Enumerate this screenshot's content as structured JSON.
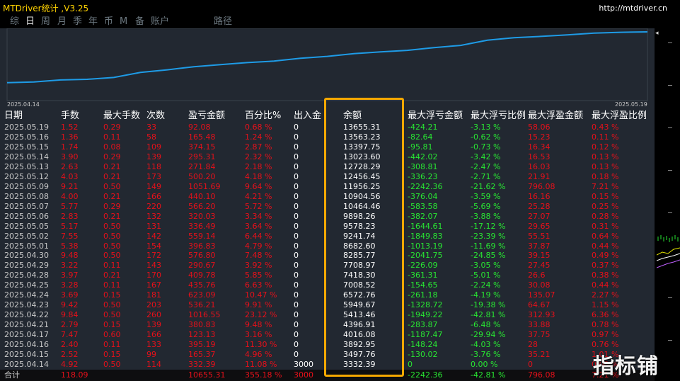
{
  "app": {
    "title": "MTDriver统计 ,V3.25",
    "url": "http://mtdriver.cn"
  },
  "tabs": [
    "综",
    "日",
    "周",
    "月",
    "季",
    "年",
    "币",
    "M",
    "备",
    "账户",
    "路径"
  ],
  "active_tab": 1,
  "chart": {
    "start_label": "2025.04.14",
    "end_label": "2025.05.19",
    "line_color": "#1e9be6"
  },
  "columns": [
    "日期",
    "手数",
    "最大手数",
    "次数",
    "盈亏金额",
    "百分比%",
    "出入金",
    "余额",
    "最大浮亏金额",
    "最大浮亏比例",
    "最大浮盈金额",
    "最大浮盈比例"
  ],
  "rows": [
    [
      "2025.05.19",
      "1.52",
      "0.29",
      "33",
      "92.08",
      "0.68 %",
      "0",
      "13655.31",
      "-424.21",
      "-3.13 %",
      "58.06",
      "0.43 %"
    ],
    [
      "2025.05.16",
      "1.36",
      "0.11",
      "58",
      "165.48",
      "1.24 %",
      "0",
      "13563.23",
      "-82.64",
      "-0.62 %",
      "15.23",
      "0.11 %"
    ],
    [
      "2025.05.15",
      "1.74",
      "0.08",
      "109",
      "374.15",
      "2.87 %",
      "0",
      "13397.75",
      "-95.81",
      "-0.73 %",
      "16.34",
      "0.12 %"
    ],
    [
      "2025.05.14",
      "3.90",
      "0.29",
      "139",
      "295.31",
      "2.32 %",
      "0",
      "13023.60",
      "-442.02",
      "-3.42 %",
      "16.53",
      "0.13 %"
    ],
    [
      "2025.05.13",
      "2.63",
      "0.21",
      "118",
      "271.84",
      "2.18 %",
      "0",
      "12728.29",
      "-308.81",
      "-2.47 %",
      "16.03",
      "0.13 %"
    ],
    [
      "2025.05.12",
      "4.03",
      "0.21",
      "173",
      "500.20",
      "4.18 %",
      "0",
      "12456.45",
      "-336.23",
      "-2.71 %",
      "21.91",
      "0.18 %"
    ],
    [
      "2025.05.09",
      "9.21",
      "0.50",
      "149",
      "1051.69",
      "9.64 %",
      "0",
      "11956.25",
      "-2242.36",
      "-21.62 %",
      "796.08",
      "7.21 %"
    ],
    [
      "2025.05.08",
      "4.00",
      "0.21",
      "166",
      "440.10",
      "4.21 %",
      "0",
      "10904.56",
      "-376.04",
      "-3.59 %",
      "16.16",
      "0.15 %"
    ],
    [
      "2025.05.07",
      "5.77",
      "0.29",
      "220",
      "566.20",
      "5.72 %",
      "0",
      "10464.46",
      "-583.58",
      "-5.69 %",
      "25.28",
      "0.25 %"
    ],
    [
      "2025.05.06",
      "2.83",
      "0.21",
      "132",
      "320.03",
      "3.34 %",
      "0",
      "9898.26",
      "-382.07",
      "-3.88 %",
      "27.07",
      "0.28 %"
    ],
    [
      "2025.05.05",
      "5.17",
      "0.50",
      "131",
      "336.49",
      "3.64 %",
      "0",
      "9578.23",
      "-1644.61",
      "-17.12 %",
      "29.65",
      "0.31 %"
    ],
    [
      "2025.05.02",
      "7.55",
      "0.50",
      "142",
      "559.14",
      "6.44 %",
      "0",
      "9241.74",
      "-1849.83",
      "-23.39 %",
      "55.51",
      "0.64 %"
    ],
    [
      "2025.05.01",
      "5.38",
      "0.50",
      "154",
      "396.83",
      "4.79 %",
      "0",
      "8682.60",
      "-1013.19",
      "-11.69 %",
      "37.87",
      "0.44 %"
    ],
    [
      "2025.04.30",
      "9.48",
      "0.50",
      "172",
      "576.80",
      "7.48 %",
      "0",
      "8285.77",
      "-2041.75",
      "-24.85 %",
      "39.15",
      "0.49 %"
    ],
    [
      "2025.04.29",
      "3.22",
      "0.11",
      "143",
      "290.67",
      "3.92 %",
      "0",
      "7708.97",
      "-226.09",
      "-3.05 %",
      "27.45",
      "0.37 %"
    ],
    [
      "2025.04.28",
      "3.97",
      "0.21",
      "170",
      "409.78",
      "5.85 %",
      "0",
      "7418.30",
      "-361.31",
      "-5.01 %",
      "26.6",
      "0.38 %"
    ],
    [
      "2025.04.25",
      "3.28",
      "0.11",
      "167",
      "435.76",
      "6.63 %",
      "0",
      "7008.52",
      "-154.65",
      "-2.24 %",
      "30.08",
      "0.44 %"
    ],
    [
      "2025.04.24",
      "3.69",
      "0.15",
      "181",
      "623.09",
      "10.47 %",
      "0",
      "6572.76",
      "-261.18",
      "-4.19 %",
      "135.07",
      "2.27 %"
    ],
    [
      "2025.04.23",
      "9.42",
      "0.50",
      "203",
      "536.21",
      "9.91 %",
      "0",
      "5949.67",
      "-1328.72",
      "-19.38 %",
      "64.67",
      "1.15 %"
    ],
    [
      "2025.04.22",
      "9.84",
      "0.50",
      "260",
      "1016.55",
      "23.12 %",
      "0",
      "5413.46",
      "-1949.22",
      "-42.81 %",
      "312.93",
      "6.36 %"
    ],
    [
      "2025.04.21",
      "2.79",
      "0.15",
      "139",
      "380.83",
      "9.48 %",
      "0",
      "4396.91",
      "-283.87",
      "-6.48 %",
      "33.88",
      "0.78 %"
    ],
    [
      "2025.04.17",
      "7.47",
      "0.60",
      "166",
      "123.13",
      "3.16 %",
      "0",
      "4016.08",
      "-1187.47",
      "-29.94 %",
      "37.75",
      "0.97 %"
    ],
    [
      "2025.04.16",
      "2.40",
      "0.11",
      "133",
      "395.19",
      "11.30 %",
      "0",
      "3892.95",
      "-148.24",
      "-4.03 %",
      "28",
      "0.76 %"
    ],
    [
      "2025.04.15",
      "2.52",
      "0.15",
      "99",
      "165.37",
      "4.96 %",
      "0",
      "3497.76",
      "-130.02",
      "-3.76 %",
      "35.21",
      "1.01 %"
    ],
    [
      "2025.04.14",
      "4.92",
      "0.50",
      "114",
      "332.39",
      "11.08 %",
      "3000",
      "3332.39",
      "0",
      "0.00 %",
      "0",
      "0.00 %"
    ]
  ],
  "totals": [
    "合计",
    "118.09",
    "",
    "",
    "10655.31",
    "355.18 %",
    "3000",
    "",
    "-2242.36",
    "-42.81 %",
    "796.08",
    "7.21 %"
  ],
  "watermark": "指标铺",
  "colors": {
    "title": "#ffd200",
    "red": "#e8101a",
    "green": "#28e632",
    "highlight": "#f5a800",
    "panel": "#222831"
  }
}
